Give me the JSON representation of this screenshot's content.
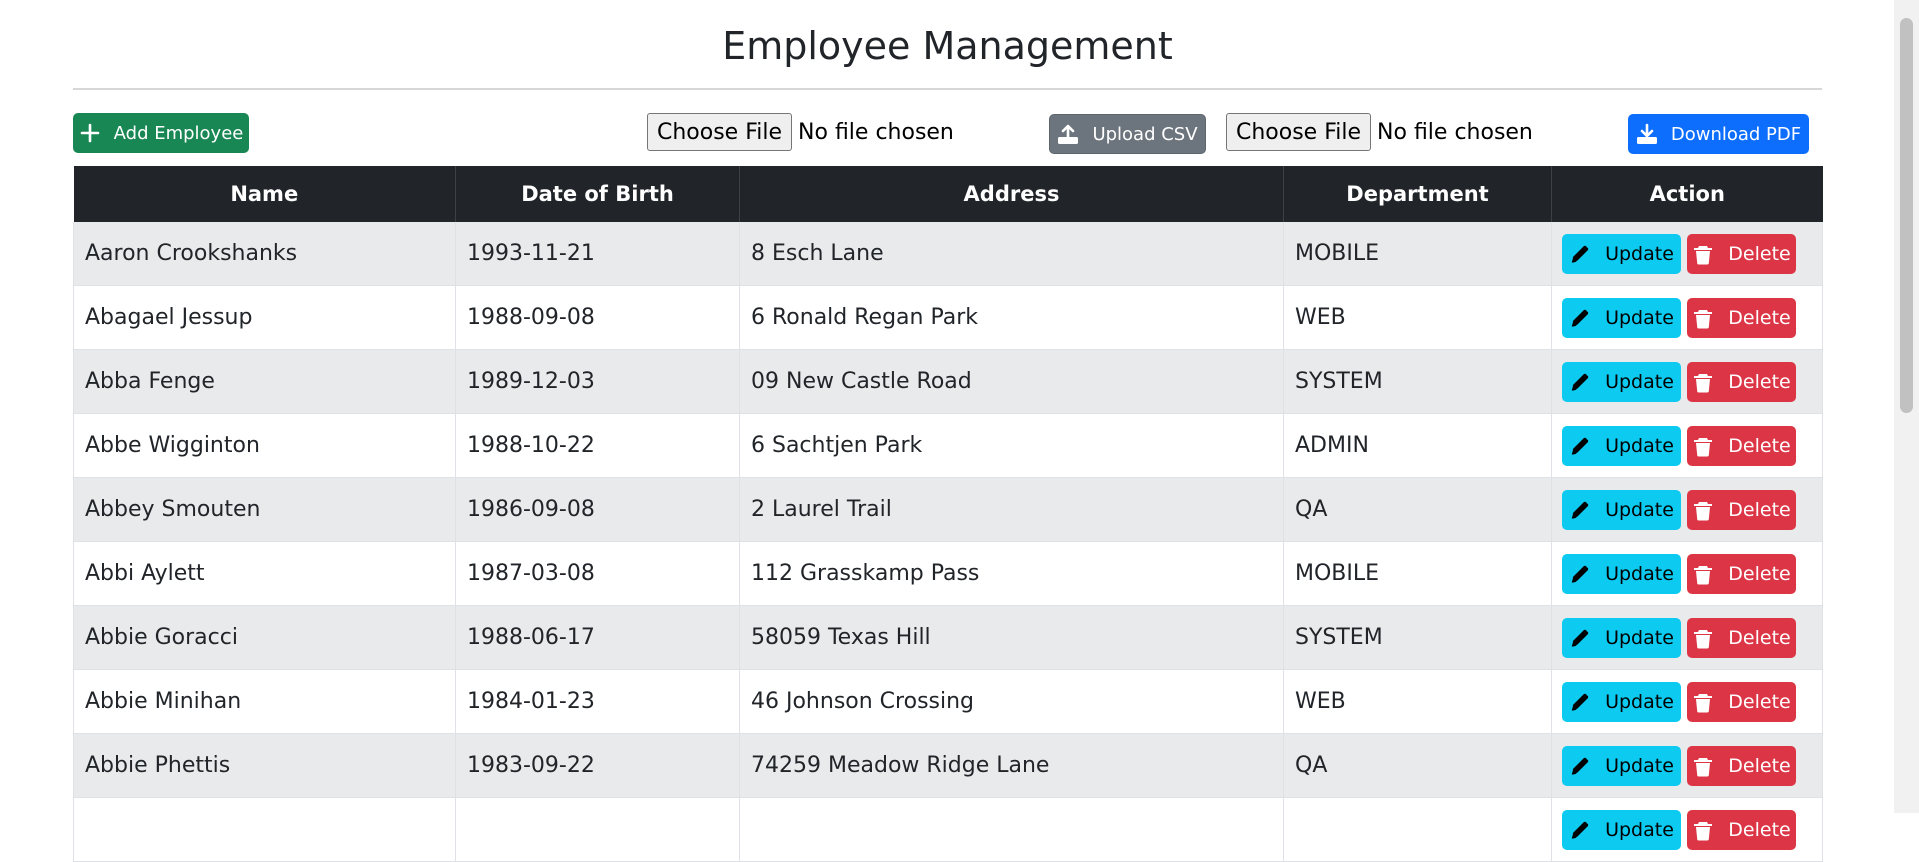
{
  "header": {
    "title": "Employee Management"
  },
  "toolbar": {
    "add_label": "Add Employee",
    "file1": {
      "button": "Choose File",
      "status": "No file chosen"
    },
    "upload_label": "Upload CSV",
    "file2": {
      "button": "Choose File",
      "status": "No file chosen"
    },
    "download_label": "Download PDF"
  },
  "table": {
    "columns": [
      "Name",
      "Date of Birth",
      "Address",
      "Department",
      "Action"
    ],
    "update_label": "Update",
    "delete_label": "Delete",
    "rows": [
      {
        "name": "Aaron Crookshanks",
        "dob": "1993-11-21",
        "address": "8 Esch Lane",
        "department": "MOBILE"
      },
      {
        "name": "Abagael Jessup",
        "dob": "1988-09-08",
        "address": "6 Ronald Regan Park",
        "department": "WEB"
      },
      {
        "name": "Abba Fenge",
        "dob": "1989-12-03",
        "address": "09 New Castle Road",
        "department": "SYSTEM"
      },
      {
        "name": "Abbe Wigginton",
        "dob": "1988-10-22",
        "address": "6 Sachtjen Park",
        "department": "ADMIN"
      },
      {
        "name": "Abbey Smouten",
        "dob": "1986-09-08",
        "address": "2 Laurel Trail",
        "department": "QA"
      },
      {
        "name": "Abbi Aylett",
        "dob": "1987-03-08",
        "address": "112 Grasskamp Pass",
        "department": "MOBILE"
      },
      {
        "name": "Abbie Goracci",
        "dob": "1988-06-17",
        "address": "58059 Texas Hill",
        "department": "SYSTEM"
      },
      {
        "name": "Abbie Minihan",
        "dob": "1984-01-23",
        "address": "46 Johnson Crossing",
        "department": "WEB"
      },
      {
        "name": "Abbie Phettis",
        "dob": "1983-09-22",
        "address": "74259 Meadow Ridge Lane",
        "department": "QA"
      },
      {
        "name": "",
        "dob": "",
        "address": "",
        "department": ""
      }
    ]
  },
  "colors": {
    "add": "#198754",
    "upload": "#6c757d",
    "download": "#0d6efd",
    "header_bg": "#212529",
    "update": "#0dcaf0",
    "delete": "#dc3545"
  }
}
